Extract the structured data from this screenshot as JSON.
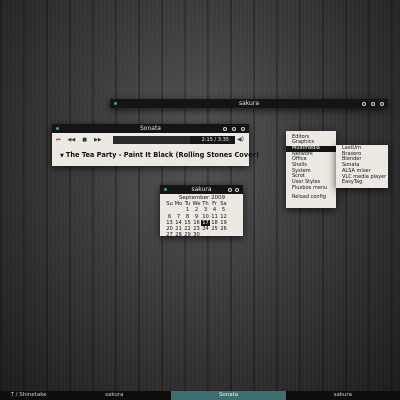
{
  "top_window": {
    "title": "sakura"
  },
  "sonata": {
    "title": "Sonata",
    "controls": [
      "⏮",
      "◀◀",
      "■",
      "▶▶"
    ],
    "time": "2:15 / 3:35",
    "progress_fraction": 0.63,
    "song": "The Tea Party - Paint It Black (Rolling Stones Cover)"
  },
  "calendar": {
    "title": "sakura",
    "month": "September 2009",
    "weekdays": [
      "Su",
      "Mo",
      "Tu",
      "We",
      "Th",
      "Fr",
      "Sa"
    ],
    "weeks": [
      [
        "",
        "",
        "1",
        "2",
        "3",
        "4",
        "5"
      ],
      [
        "6",
        "7",
        "8",
        "9",
        "10",
        "11",
        "12"
      ],
      [
        "13",
        "14",
        "15",
        "16",
        "17",
        "18",
        "19"
      ],
      [
        "20",
        "21",
        "22",
        "23",
        "24",
        "25",
        "26"
      ],
      [
        "27",
        "28",
        "29",
        "30",
        "",
        "",
        ""
      ]
    ],
    "today": "17"
  },
  "menu": {
    "items": [
      "Editors",
      "Graphics",
      "Multimedia",
      "Network",
      "Office",
      "Shells",
      "System",
      "Scrot",
      "User Styles",
      "Fluxbox menu"
    ],
    "active": "Multimedia",
    "footer": "Reload config"
  },
  "submenu": {
    "items": [
      "LastUrn",
      "Brasero",
      "Blender",
      "Sonata",
      "ALSA mixer",
      "VLC media player",
      "EasyTag"
    ]
  },
  "taskbar": {
    "items": [
      {
        "label": "T / Shinetake",
        "active": false,
        "width": 1
      },
      {
        "label": "sakura",
        "active": false,
        "width": 2
      },
      {
        "label": "Sonata",
        "active": true,
        "width": 2
      },
      {
        "label": "sakura",
        "active": false,
        "width": 2
      }
    ]
  },
  "colors": {
    "accent": "#3aa4a4",
    "titlebar": "#141414",
    "panel": "#ece9e2",
    "active_task": "#3e6f6f"
  }
}
